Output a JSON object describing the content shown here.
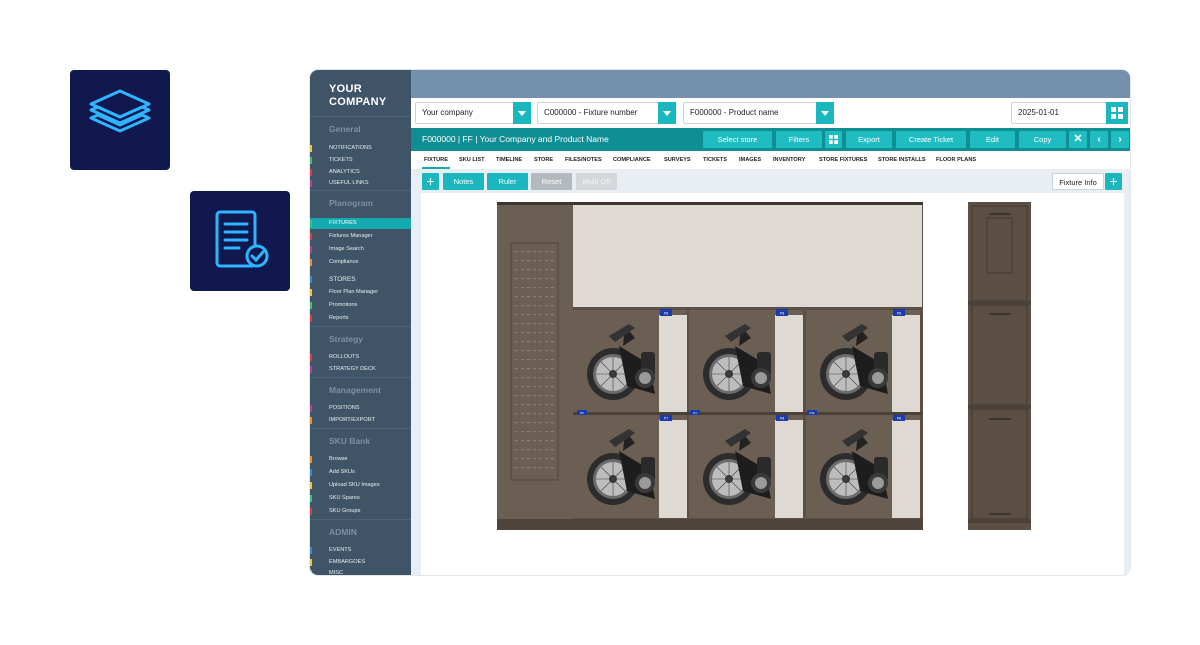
{
  "tiles": [
    {
      "icon": "layers-icon"
    },
    {
      "icon": "document-check-icon"
    }
  ],
  "brand": {
    "line1": "YOUR",
    "line2": "COMPANY"
  },
  "sidebar": {
    "sections": [
      {
        "title": "General",
        "items": [
          "NOTIFICATIONS",
          "TICKETS",
          "ANALYTICS",
          "USEFUL LINKS"
        ]
      },
      {
        "title": "Planogram",
        "items": [
          "FIXTURES",
          "Fixtures Manager",
          "Image Search",
          "Compliance",
          "STORES",
          "Floor Plan Manager",
          "Promotions",
          "Reports"
        ]
      },
      {
        "title": "Strategy",
        "items": [
          "ROLLOUTS",
          "STRATEGY DECK"
        ]
      },
      {
        "title": "Management",
        "items": [
          "POSITIONS",
          "IMPORT/EXPORT"
        ]
      },
      {
        "title": "SKU Bank",
        "items": [
          "Browse",
          "Add SKUs",
          "Upload SKU Images",
          "SKU Spares",
          "SKU Groups"
        ]
      },
      {
        "title": "ADMIN",
        "items": [
          "EVENTS",
          "EMBARGOES",
          "MISC"
        ]
      }
    ],
    "marker_colors": [
      "#f2c53d",
      "#3ac27a",
      "#e23b3b",
      "#c0399a",
      "#f28c28",
      "#2f8bd8"
    ]
  },
  "filters": {
    "company": "Your company",
    "fixture": "C000000 - Fixture number",
    "product": "F000000 - Product name",
    "date": "2025-01-01"
  },
  "titlebar": {
    "title": "F000000 | FF | Your Company and Product Name",
    "buttons": [
      "Select store",
      "Filters",
      "Export",
      "Create Ticket",
      "Edit",
      "Copy"
    ]
  },
  "tabs": [
    "FIXTURE",
    "SKU LIST",
    "TIMELINE",
    "STORE",
    "FILES/NOTES",
    "COMPLIANCE",
    "SURVEYS",
    "TICKETS",
    "IMAGES",
    "INVENTORY",
    "STORE FIXTURES",
    "STORE INSTALLS",
    "FLOOR PLANS"
  ],
  "actions": {
    "notes": "Notes",
    "ruler": "Ruler",
    "reset": "Reset",
    "multi": "Multi Off",
    "fixture_info": "Fixture Info"
  },
  "fixture": {
    "bay_labels": [
      "P8",
      "P8",
      "P8",
      "P7",
      "P8",
      "P8"
    ],
    "left_labels": [
      "P2",
      "P4",
      "P11"
    ],
    "colors": {
      "frame": "#5b4f45",
      "panel": "#6b5e53",
      "shelf": "#dedad3",
      "tag": "#1c3aa8"
    }
  }
}
